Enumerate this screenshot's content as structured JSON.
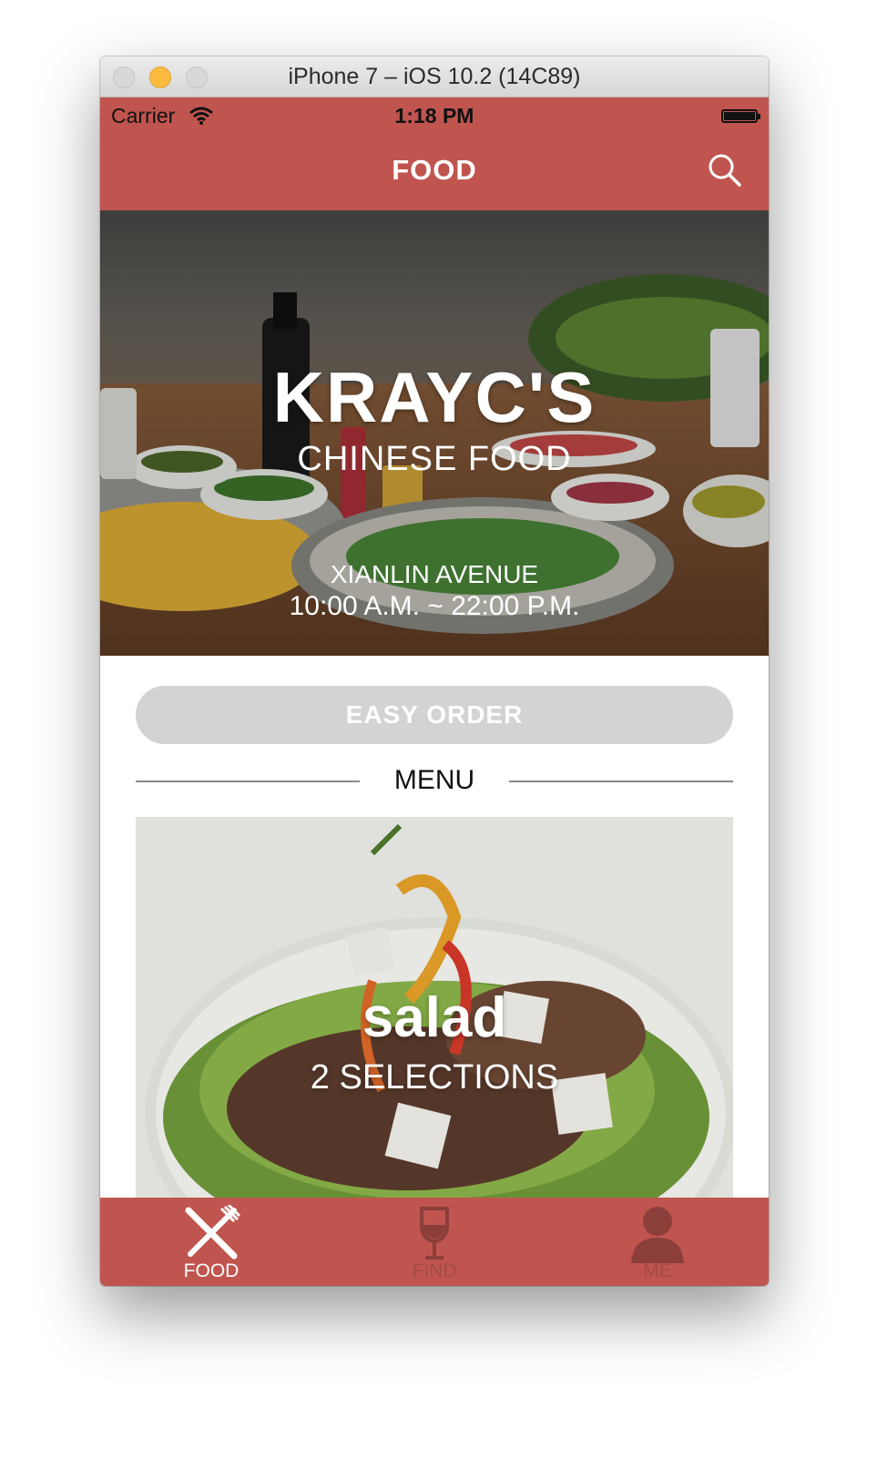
{
  "window": {
    "title": "iPhone 7 – iOS 10.2 (14C89)"
  },
  "status_bar": {
    "carrier": "Carrier",
    "time": "1:18 PM"
  },
  "nav": {
    "title": "FOOD",
    "search_icon": "search-icon"
  },
  "restaurant": {
    "name": "KRAYC'S",
    "cuisine": "CHINESE FOOD",
    "address": "XIANLIN AVENUE",
    "hours": "10:00 A.M. ~ 22:00 P.M."
  },
  "actions": {
    "easy_order": "EASY ORDER"
  },
  "menu": {
    "section_label": "MENU",
    "items": [
      {
        "name": "salad",
        "count_label": "2 SELECTIONS"
      }
    ]
  },
  "tabs": [
    {
      "label": "FOOD",
      "icon": "fork-knife-icon",
      "active": true
    },
    {
      "label": "FIND",
      "icon": "wine-glass-icon",
      "active": false
    },
    {
      "label": "ME",
      "icon": "person-icon",
      "active": false
    }
  ],
  "colors": {
    "brand": "#c0554f",
    "button_disabled": "#d3d3d3",
    "inactive_tab": "#a34b46"
  }
}
